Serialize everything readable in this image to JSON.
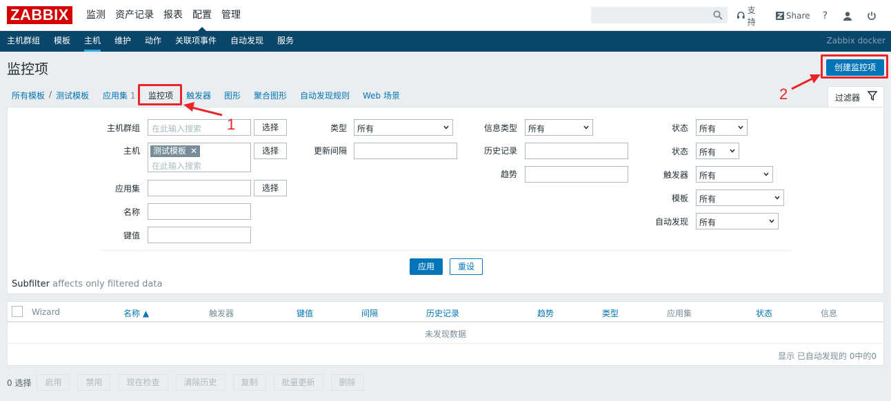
{
  "header": {
    "logo": "ZABBIX",
    "nav": [
      "监测",
      "资产记录",
      "报表",
      "配置",
      "管理"
    ],
    "active_nav": "配置",
    "search_placeholder": "",
    "links": {
      "support": "支持",
      "share": "Share",
      "help": "?"
    }
  },
  "subnav": {
    "items": [
      "主机群组",
      "模板",
      "主机",
      "维护",
      "动作",
      "关联项事件",
      "自动发现",
      "服务"
    ],
    "active": "主机",
    "right_label": "Zabbix docker"
  },
  "page": {
    "title": "监控项",
    "create_button": "创建监控项"
  },
  "breadcrumb": {
    "all_templates": "所有模板",
    "separator": "/",
    "template": "测试模板",
    "tabs": {
      "applications": "应用集",
      "applications_count": "1",
      "items": "监控项",
      "triggers": "触发器",
      "graphs": "图形",
      "screens": "聚合图形",
      "discovery": "自动发现规则",
      "web": "Web 场景"
    }
  },
  "filter": {
    "tab_label": "过滤器",
    "host_group_label": "主机群组",
    "host_group_placeholder": "在此输入搜索",
    "host_label": "主机",
    "host_chip": "测试模板",
    "host_chip_remove": "✕",
    "host_placeholder": "在此输入搜索",
    "application_label": "应用集",
    "name_label": "名称",
    "key_label": "键值",
    "select_button": "选择",
    "type_label": "类型",
    "type_value": "所有",
    "interval_label": "更新间隔",
    "info_type_label": "信息类型",
    "info_type_value": "所有",
    "history_label": "历史记录",
    "trends_label": "趋势",
    "state_label": "状态",
    "state_value": "所有",
    "status_label": "状态",
    "status_value": "所有",
    "triggers_label": "触发器",
    "triggers_value": "所有",
    "template_label": "模板",
    "template_value": "所有",
    "discovery_label": "自动发现",
    "discovery_value": "所有",
    "apply_button": "应用",
    "reset_button": "重设",
    "subfilter_label": "Subfilter",
    "subfilter_note": "affects only filtered data"
  },
  "table": {
    "columns": [
      "Wizard",
      "名称 ▲",
      "触发器",
      "键值",
      "间隔",
      "历史记录",
      "趋势",
      "类型",
      "应用集",
      "状态",
      "信息"
    ],
    "empty_message": "未发现数据",
    "footer": "显示 已自动发现的 0中的0"
  },
  "actions": {
    "selected_count": "0 选择",
    "buttons": [
      "启用",
      "禁用",
      "现在检查",
      "清除历史",
      "复制",
      "批量更新",
      "删除"
    ]
  },
  "annotations": {
    "label_1": "1",
    "label_2": "2",
    "color": "#e8262a"
  }
}
